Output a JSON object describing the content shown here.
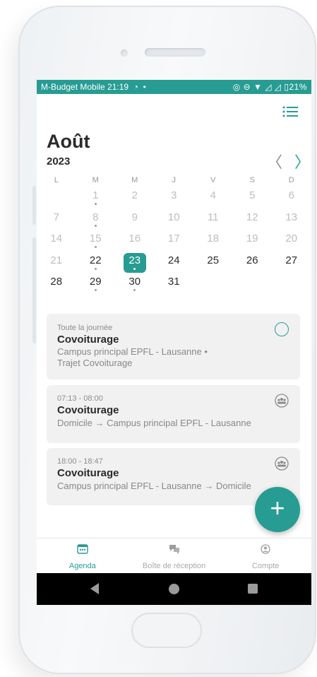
{
  "status_bar": {
    "carrier_time": "M-Budget Mobile 21:19",
    "battery": "21%"
  },
  "header": {
    "month": "Août",
    "year": "2023",
    "prev_icon": "chevron-left-icon",
    "next_icon": "chevron-right-icon",
    "list_icon": "list-icon"
  },
  "calendar": {
    "weekdays": [
      "L",
      "M",
      "M",
      "J",
      "V",
      "S",
      "D"
    ],
    "weeks": [
      [
        {
          "d": ""
        },
        {
          "d": "1",
          "s": "faded",
          "dot": true
        },
        {
          "d": "2",
          "s": "faded"
        },
        {
          "d": "3",
          "s": "faded"
        },
        {
          "d": "4",
          "s": "faded"
        },
        {
          "d": "5",
          "s": "faded"
        },
        {
          "d": "6",
          "s": "faded"
        }
      ],
      [
        {
          "d": "7",
          "s": "faded"
        },
        {
          "d": "8",
          "s": "faded",
          "dot": true
        },
        {
          "d": "9",
          "s": "faded"
        },
        {
          "d": "10",
          "s": "faded"
        },
        {
          "d": "11",
          "s": "faded"
        },
        {
          "d": "12",
          "s": "faded"
        },
        {
          "d": "13",
          "s": "faded"
        }
      ],
      [
        {
          "d": "14",
          "s": "faded"
        },
        {
          "d": "15",
          "s": "faded",
          "dot": true
        },
        {
          "d": "16",
          "s": "faded"
        },
        {
          "d": "17",
          "s": "faded"
        },
        {
          "d": "18",
          "s": "faded"
        },
        {
          "d": "19",
          "s": "faded"
        },
        {
          "d": "20",
          "s": "faded"
        }
      ],
      [
        {
          "d": "21",
          "s": "faded"
        },
        {
          "d": "22",
          "s": "current",
          "dot": true
        },
        {
          "d": "23",
          "s": "selected",
          "dot": true
        },
        {
          "d": "24",
          "s": "current"
        },
        {
          "d": "25",
          "s": "current"
        },
        {
          "d": "26",
          "s": "current"
        },
        {
          "d": "27",
          "s": "current"
        }
      ],
      [
        {
          "d": "28",
          "s": "current"
        },
        {
          "d": "29",
          "s": "current",
          "dot": true
        },
        {
          "d": "30",
          "s": "current",
          "dot": true
        },
        {
          "d": "31",
          "s": "current"
        },
        {
          "d": ""
        },
        {
          "d": ""
        },
        {
          "d": ""
        }
      ]
    ]
  },
  "events": [
    {
      "time": "Toute la journée",
      "title": "Covoiturage",
      "desc_line1": "Campus principal EPFL - Lausanne •",
      "desc_line2": "Trajet Covoiturage",
      "icon": "circle-outline-icon"
    },
    {
      "time": "07:13 - 08:00",
      "title": "Covoiturage",
      "desc_line1": "Domicile → Campus principal EPFL - Lausanne",
      "icon": "group-icon"
    },
    {
      "time": "18:00 - 18:47",
      "title": "Covoiturage",
      "desc_line1": "Campus principal EPFL - Lausanne → Domicile",
      "icon": "group-icon"
    }
  ],
  "fab": {
    "label": "+"
  },
  "bottom_nav": [
    {
      "label": "Agenda",
      "icon": "calendar-icon",
      "active": true
    },
    {
      "label": "Boîte de réception",
      "icon": "chat-bubbles-icon",
      "active": false
    },
    {
      "label": "Compte",
      "icon": "account-icon",
      "active": false
    }
  ],
  "colors": {
    "accent": "#279c93",
    "card_bg": "#f1f1f1",
    "text_dark": "#2a2a2a",
    "text_muted": "#888888"
  }
}
